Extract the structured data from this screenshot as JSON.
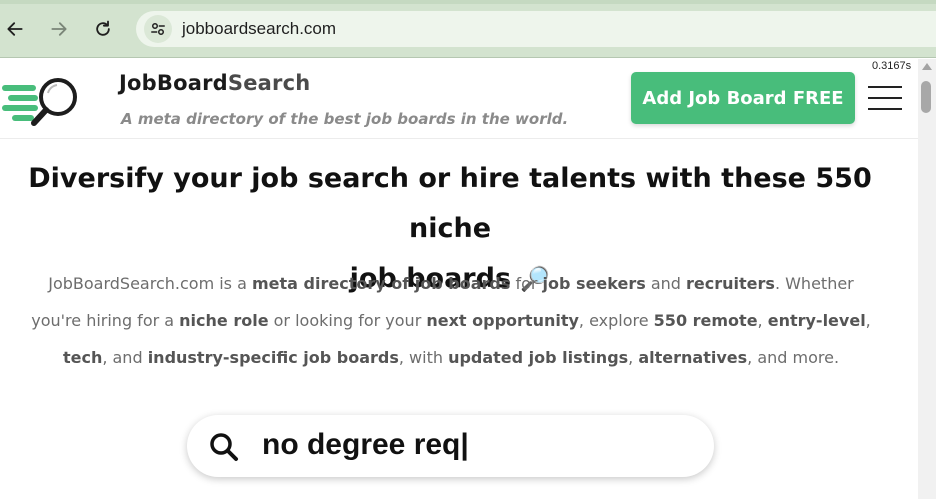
{
  "browser": {
    "url": "jobboardsearch.com",
    "icons": {
      "back": "arrow-left-icon",
      "forward": "arrow-right-icon",
      "reload": "reload-icon",
      "site_info": "tune-icon"
    }
  },
  "header": {
    "brand_bold": "JobBoard",
    "brand_light": "Search",
    "tagline": "A meta directory of the best job boards in the world.",
    "cta_label": "Add Job Board FREE",
    "menu_icon": "hamburger-menu-icon",
    "logo_icon": "magnifier-logo-icon"
  },
  "timer": "0.3167s",
  "hero": {
    "headline_line1": "Diversify your job search or hire talents with these 550 niche",
    "headline_line2": "job boards",
    "headline_emoji": "🔎",
    "intro": [
      {
        "t": "JobBoardSearch.com is a ",
        "b": false
      },
      {
        "t": "meta directory of job boards",
        "b": true
      },
      {
        "t": " for ",
        "b": false
      },
      {
        "t": "job seekers",
        "b": true
      },
      {
        "t": " and ",
        "b": false
      },
      {
        "t": "recruiters",
        "b": true
      },
      {
        "t": ". Whether you're hiring for a ",
        "b": false
      },
      {
        "t": "niche role",
        "b": true
      },
      {
        "t": " or looking for your ",
        "b": false
      },
      {
        "t": "next opportunity",
        "b": true
      },
      {
        "t": ", explore ",
        "b": false
      },
      {
        "t": "550 remote",
        "b": true
      },
      {
        "t": ", ",
        "b": false
      },
      {
        "t": "entry-level",
        "b": true
      },
      {
        "t": ", ",
        "b": false
      },
      {
        "t": "tech",
        "b": true
      },
      {
        "t": ", and ",
        "b": false
      },
      {
        "t": "industry-specific job boards",
        "b": true
      },
      {
        "t": ", with ",
        "b": false
      },
      {
        "t": "updated job listings",
        "b": true
      },
      {
        "t": ", ",
        "b": false
      },
      {
        "t": "alternatives",
        "b": true
      },
      {
        "t": ", and more.",
        "b": false
      }
    ]
  },
  "search": {
    "value": "no degree req|",
    "icon": "search-icon"
  },
  "colors": {
    "accent": "#48bd7b",
    "chrome": "#d3e3cf"
  }
}
